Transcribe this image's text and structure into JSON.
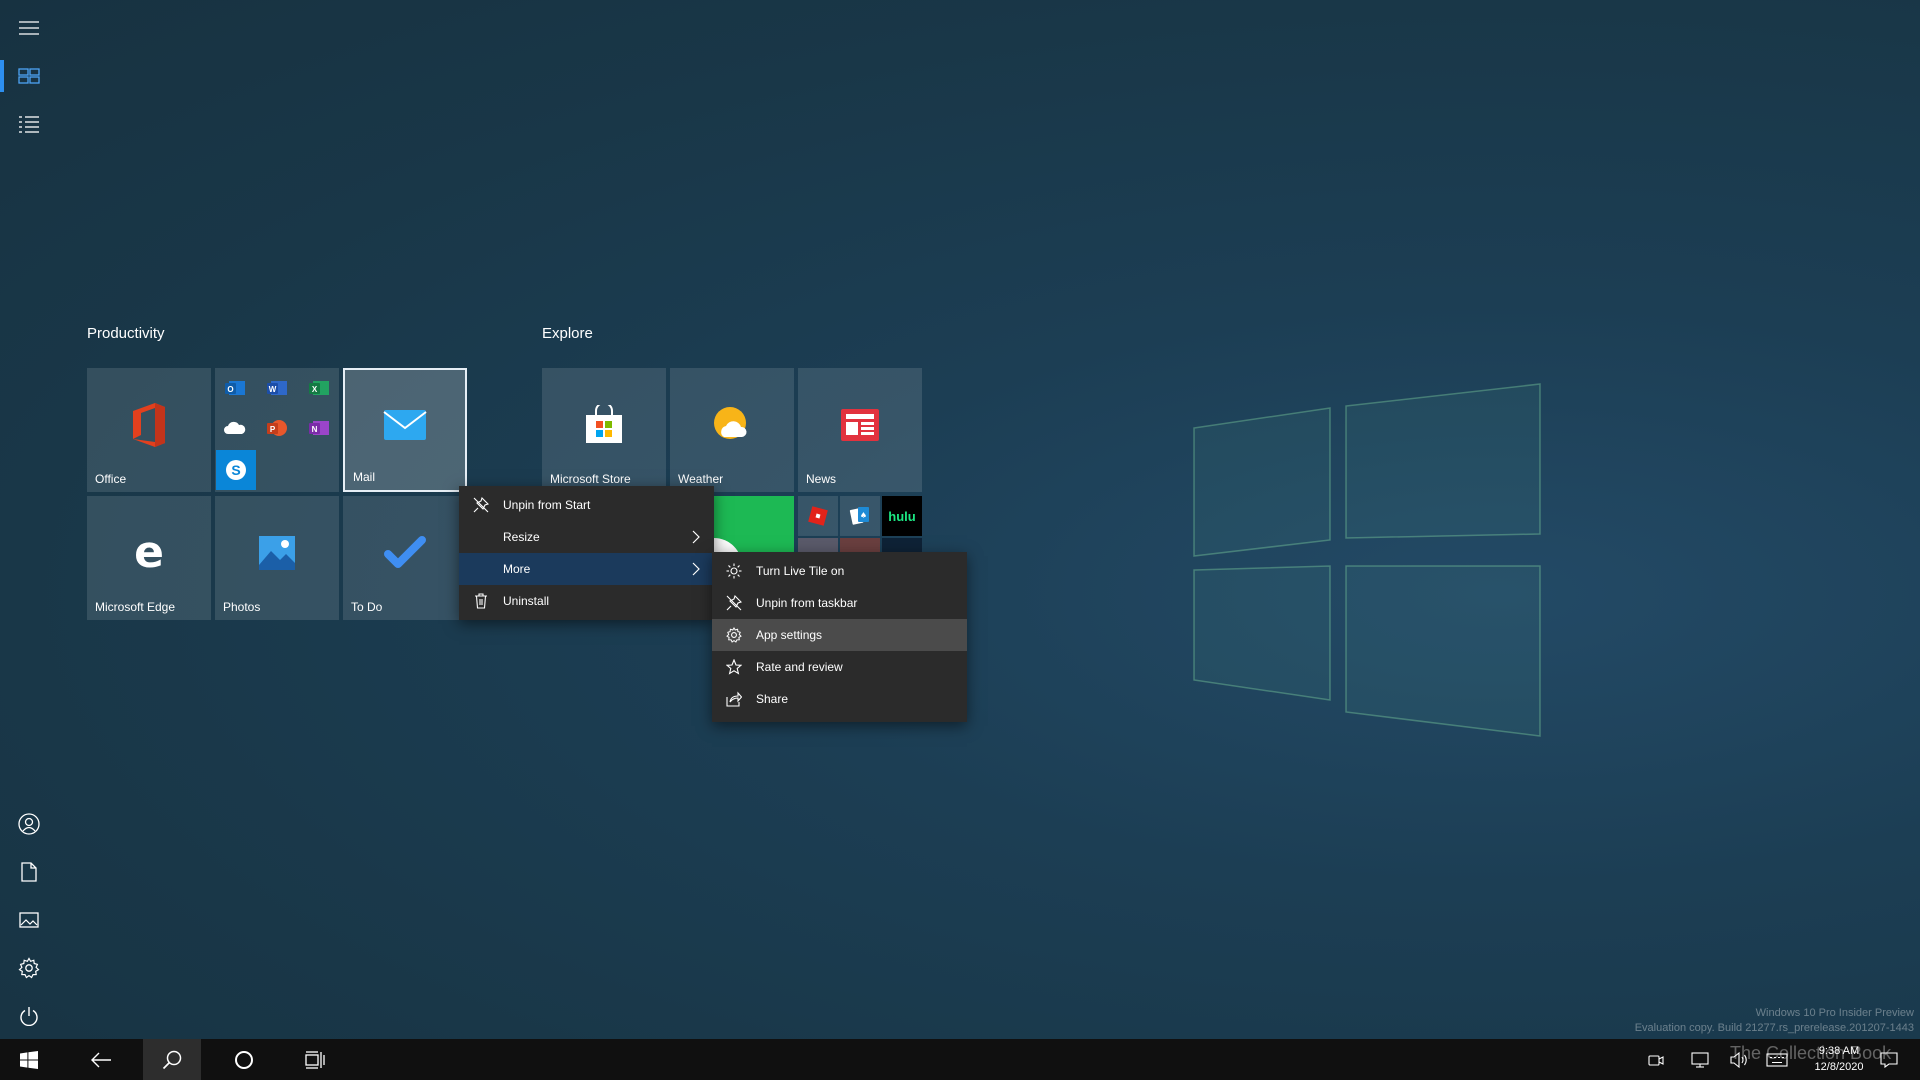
{
  "start": {
    "groups": [
      {
        "title": "Productivity"
      },
      {
        "title": "Explore"
      }
    ],
    "tiles": {
      "office": "Office",
      "mail": "Mail",
      "edge": "Microsoft Edge",
      "photos": "Photos",
      "todo": "To Do",
      "store": "Microsoft Store",
      "weather": "Weather",
      "news": "News",
      "hulu": "hulu"
    }
  },
  "context_menu": {
    "items": [
      "Unpin from Start",
      "Resize",
      "More",
      "Uninstall"
    ]
  },
  "submenu": {
    "items": [
      "Turn Live Tile on",
      "Unpin from taskbar",
      "App settings",
      "Rate and review",
      "Share"
    ]
  },
  "taskbar": {
    "time": "9:38 AM",
    "date": "12/8/2020"
  },
  "watermark": {
    "line1": "Windows 10 Pro Insider Preview",
    "line2": "Evaluation copy. Build 21277.rs_prerelease.201207-1443",
    "overlay": "The Collection Book"
  },
  "colors": {
    "accent": "#2d8ff0",
    "menu_bg": "#2b2b2b",
    "menu_highlight": "#1b3a5c",
    "taskbar": "#101010"
  }
}
